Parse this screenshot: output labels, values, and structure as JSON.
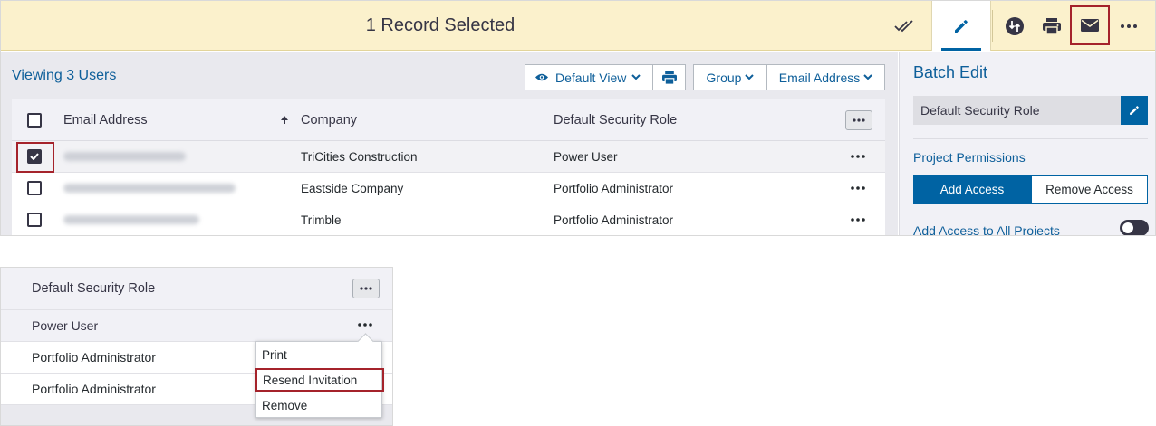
{
  "header": {
    "selection_title": "1 Record Selected",
    "icons": [
      "double-check-icon",
      "pencil-icon",
      "sync-icon",
      "printer-icon",
      "envelope-icon",
      "more-horizontal-icon"
    ]
  },
  "users": {
    "viewing_label": "Viewing 3 Users",
    "toolbar": {
      "default_view_label": "Default View",
      "group_label": "Group",
      "email_address_label": "Email Address"
    },
    "columns": {
      "email": "Email Address",
      "company": "Company",
      "role": "Default Security Role"
    },
    "rows": [
      {
        "checked": true,
        "company": "TriCities Construction",
        "role": "Power User"
      },
      {
        "checked": false,
        "company": "Eastside Company",
        "role": "Portfolio Administrator"
      },
      {
        "checked": false,
        "company": "Trimble",
        "role": "Portfolio Administrator"
      }
    ]
  },
  "batch_edit": {
    "title": "Batch Edit",
    "role_field_value": "Default Security Role",
    "permissions_label": "Project Permissions",
    "add_access_label": "Add Access",
    "remove_access_label": "Remove Access",
    "all_projects_label": "Add Access to All Projects",
    "all_projects_on": false
  },
  "detail": {
    "header": "Default Security Role",
    "rows": [
      "Power User",
      "Portfolio Administrator",
      "Portfolio Administrator"
    ],
    "menu": [
      "Print",
      "Resend Invitation",
      "Remove"
    ]
  },
  "colors": {
    "accent": "#0063a3",
    "highlight": "#a5232b",
    "selection_bar": "#fbf1cc"
  }
}
